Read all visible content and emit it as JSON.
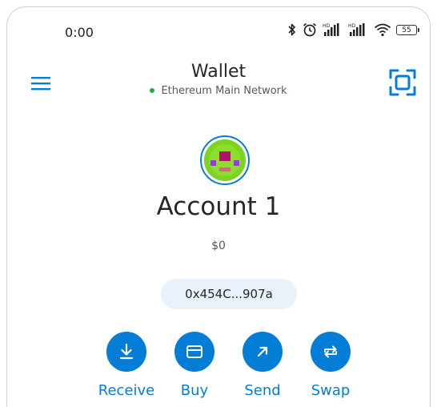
{
  "status_bar": {
    "time": "0:00",
    "battery": "55",
    "icons": [
      "bluetooth-icon",
      "alarm-icon",
      "hd-signal-icon",
      "hd-signal-icon",
      "wifi-icon",
      "battery-icon"
    ]
  },
  "header": {
    "title": "Wallet",
    "network": "Ethereum Main Network",
    "network_status_color": "#28a745",
    "menu_icon": "hamburger-menu-icon",
    "scan_icon": "qr-scan-icon"
  },
  "account": {
    "name": "Account 1",
    "balance": "$0",
    "address": "0x454C...907a"
  },
  "actions": [
    {
      "label": "Receive",
      "icon": "download-arrow-icon"
    },
    {
      "label": "Buy",
      "icon": "card-icon"
    },
    {
      "label": "Send",
      "icon": "arrow-up-right-icon"
    },
    {
      "label": "Swap",
      "icon": "swap-arrows-icon"
    }
  ],
  "colors": {
    "accent": "#037dd6",
    "address_pill_bg": "#e9f1fa",
    "text_primary": "#24272a",
    "text_secondary": "#535a61"
  }
}
